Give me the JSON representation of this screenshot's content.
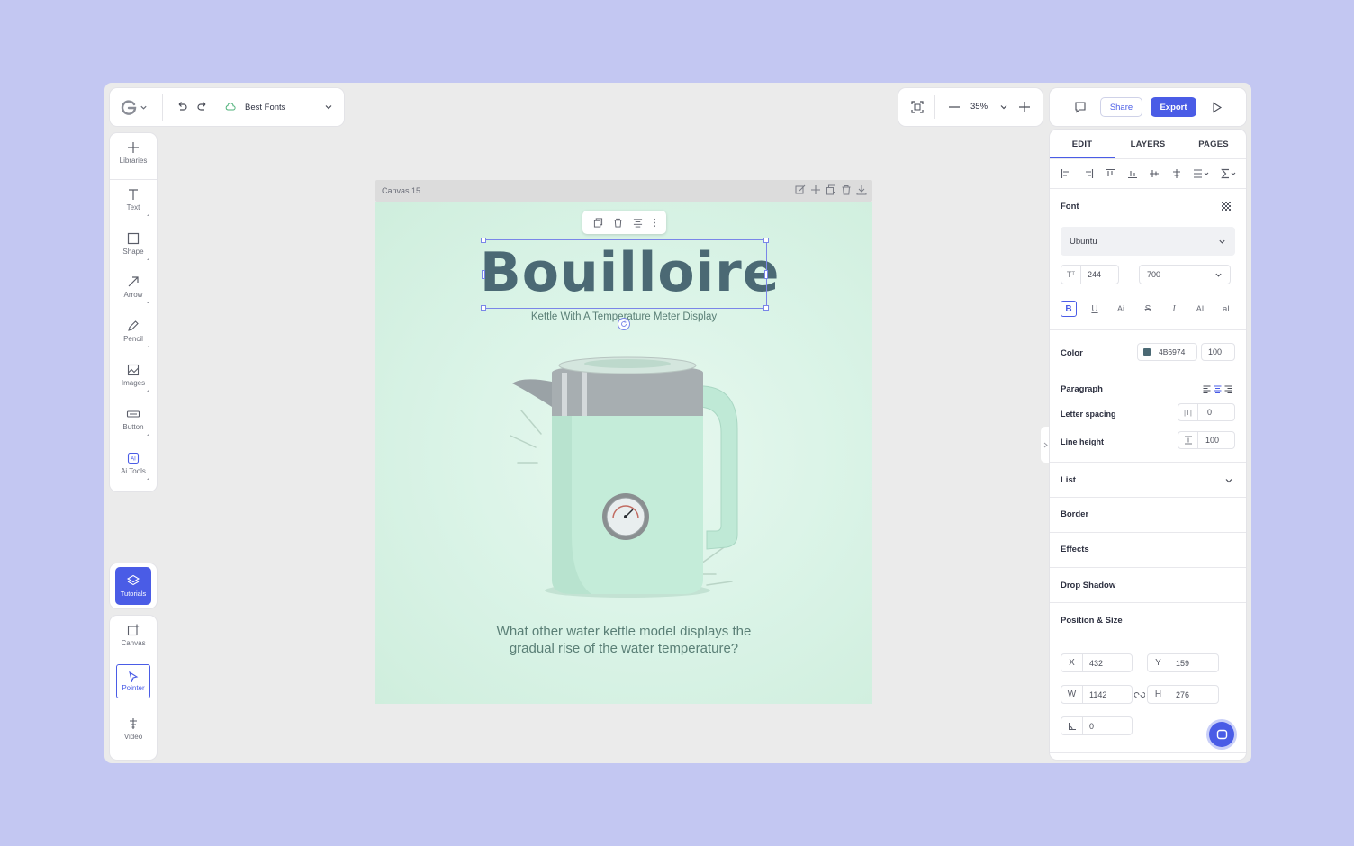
{
  "topbar": {
    "project_name": "Best Fonts",
    "zoom": "35%",
    "share_label": "Share",
    "export_label": "Export"
  },
  "left_tools": [
    {
      "label": "Libraries",
      "icon": "plus-icon"
    },
    {
      "label": "Text",
      "icon": "text-icon"
    },
    {
      "label": "Shape",
      "icon": "square-icon"
    },
    {
      "label": "Arrow",
      "icon": "arrow-icon"
    },
    {
      "label": "Pencil",
      "icon": "pencil-icon"
    },
    {
      "label": "Images",
      "icon": "image-icon"
    },
    {
      "label": "Button",
      "icon": "button-icon"
    },
    {
      "label": "Ai Tools",
      "icon": "ai-icon"
    }
  ],
  "bottom_tools": {
    "tutorials": "Tutorials",
    "canvas": "Canvas",
    "pointer": "Pointer",
    "video": "Video"
  },
  "canvas": {
    "name": "Canvas 15",
    "headline": "Bouilloire",
    "subtitle": "Kettle With A Temperature Meter Display",
    "question_line1": "What other water kettle model displays the",
    "question_line2": "gradual rise of the water temperature?"
  },
  "right_panel": {
    "tabs": [
      "EDIT",
      "LAYERS",
      "PAGES"
    ],
    "active_tab": "EDIT",
    "font_section": "Font",
    "font_family": "Ubuntu",
    "font_size": "244",
    "font_weight": "700",
    "color_label": "Color",
    "color_hex": "4B6974",
    "color_value": "#4b6974",
    "color_opacity": "100",
    "paragraph_label": "Paragraph",
    "letter_spacing_label": "Letter spacing",
    "letter_spacing": "0",
    "line_height_label": "Line height",
    "line_height": "100",
    "list_label": "List",
    "border_label": "Border",
    "effects_label": "Effects",
    "drop_shadow_label": "Drop Shadow",
    "position_size_label": "Position & Size",
    "x_label": "X",
    "x": "432",
    "y_label": "Y",
    "y": "159",
    "w_label": "W",
    "w": "1142",
    "h_label": "H",
    "h": "276",
    "rotation": "0"
  },
  "colors": {
    "accent": "#4a5ce6",
    "headline": "#4b6974",
    "canvas_bg": "#d9f3e6"
  }
}
